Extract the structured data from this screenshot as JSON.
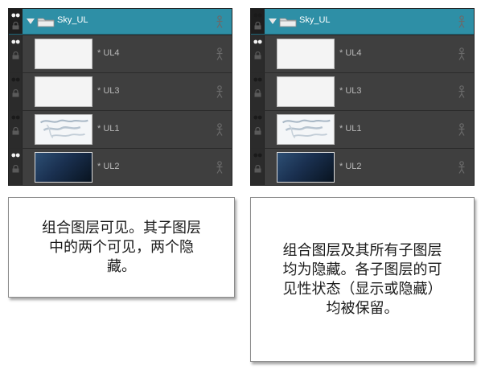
{
  "panels": [
    {
      "group": {
        "name": "Sky_UL",
        "visible": true,
        "locked": false
      },
      "layers": [
        {
          "name": "* UL4",
          "visible": true,
          "thumbnail": "white-thumbnail"
        },
        {
          "name": "* UL3",
          "visible": false,
          "thumbnail": "white-thumbnail"
        },
        {
          "name": "* UL1",
          "visible": false,
          "thumbnail": "clouds-thumbnail"
        },
        {
          "name": "* UL2",
          "visible": true,
          "thumbnail": "dark-blue-gradient-thumbnail"
        }
      ]
    },
    {
      "group": {
        "name": "Sky_UL",
        "visible": false,
        "locked": false
      },
      "layers": [
        {
          "name": "* UL4",
          "visible": true,
          "thumbnail": "white-thumbnail"
        },
        {
          "name": "* UL3",
          "visible": false,
          "thumbnail": "white-thumbnail"
        },
        {
          "name": "* UL1",
          "visible": false,
          "thumbnail": "clouds-thumbnail"
        },
        {
          "name": "* UL2",
          "visible": true,
          "thumbnail": "dark-blue-gradient-thumbnail"
        }
      ]
    }
  ],
  "callouts": {
    "left": [
      "组合图层可见。其子图层",
      "中的两个可见，两个隐",
      "藏。"
    ],
    "right": [
      "组合图层及其所有子图层",
      "均为隐藏。各子图层的可",
      "见性状态（显示或隐藏）",
      "均被保留。"
    ]
  },
  "colors": {
    "group_row": "#2e8fa6",
    "panel_bg": "#3f3f3f",
    "eye_active": "#f2f2f2",
    "eye_dim": "#1a1a1a"
  },
  "icons": [
    "eye-icon",
    "lock-icon",
    "expand-caret-icon",
    "folder-icon",
    "person-icon"
  ]
}
